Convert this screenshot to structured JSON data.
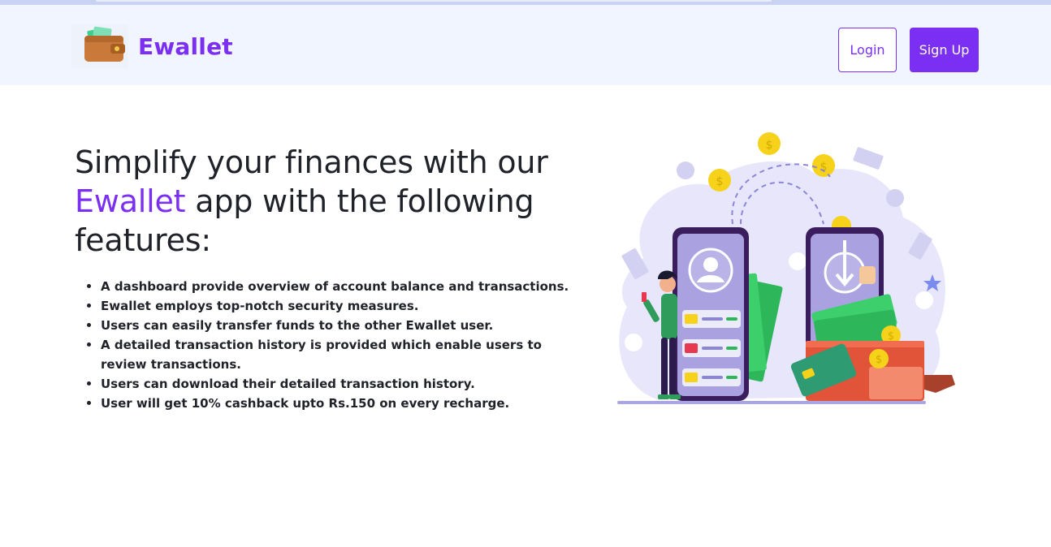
{
  "brand": {
    "name": "Ewallet",
    "logo_icon": "wallet-icon"
  },
  "nav": {
    "login_label": "Login",
    "signup_label": "Sign Up"
  },
  "hero": {
    "headline_part1": "Simplify your finances with our",
    "headline_accent": "Ewallet",
    "headline_part2": " app with the following features:"
  },
  "features": [
    "A dashboard provide overview of account balance and transactions.",
    "Ewallet employs top-notch security measures.",
    "Users can easily transfer funds to the other Ewallet user.",
    "A detailed transaction history is provided which enable users to review transactions.",
    "Users can download their detailed transaction history.",
    "User will get 10% cashback upto Rs.150 on every recharge."
  ],
  "illustration": {
    "icon": "money-transfer-illustration"
  },
  "colors": {
    "accent": "#7b2ff2",
    "navbar_bg": "#f0f5ff",
    "text": "#1f2329"
  }
}
